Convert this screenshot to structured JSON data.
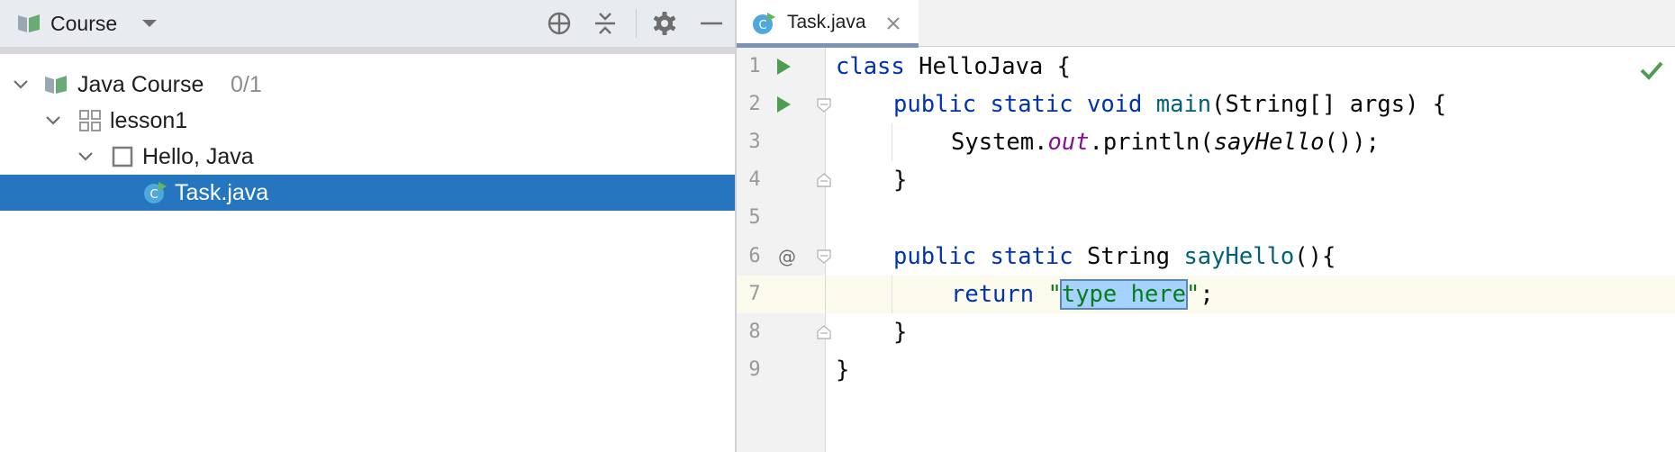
{
  "project_panel": {
    "title": "Course",
    "colors": {
      "header_bg": "#e8ebf0",
      "selection": "#2675bf",
      "course_icon": "#6aab73"
    },
    "toolbar": [
      {
        "icon": "locate-crosshair-icon"
      },
      {
        "icon": "collapse-all-icon"
      },
      {
        "icon": "gear-icon"
      },
      {
        "icon": "minimize-icon"
      }
    ],
    "tree": {
      "course": {
        "label": "Java Course",
        "progress": "0/1"
      },
      "lesson": {
        "label": "lesson1"
      },
      "task": {
        "label": "Hello, Java"
      },
      "file": {
        "label": "Task.java"
      }
    }
  },
  "editor": {
    "tab": {
      "label": "Task.java",
      "icon": "java-class-icon"
    },
    "status_icon": "check-icon",
    "line_numbers": [
      "1",
      "2",
      "3",
      "4",
      "5",
      "6",
      "7",
      "8",
      "9"
    ],
    "code": {
      "l1": {
        "kw_class": "class",
        "name": " HelloJava {"
      },
      "l2": {
        "kw1": "public",
        "kw2": "static",
        "kw3": "void",
        "fn": "main",
        "rest": "(String[] args) {"
      },
      "l3": {
        "a": "System.",
        "field": "out",
        "b": ".println(",
        "call": "sayHello",
        "c": "());"
      },
      "l4": {
        "text": "}"
      },
      "l6": {
        "kw1": "public",
        "kw2": "static",
        "type": "String",
        "fn": "sayHello",
        "rest": "(){"
      },
      "l7": {
        "kw": "return",
        "q1": "\"",
        "str": "type here",
        "q2": "\"",
        "end": ";"
      },
      "l8": {
        "text": "}"
      },
      "l9": {
        "text": "}"
      }
    }
  }
}
